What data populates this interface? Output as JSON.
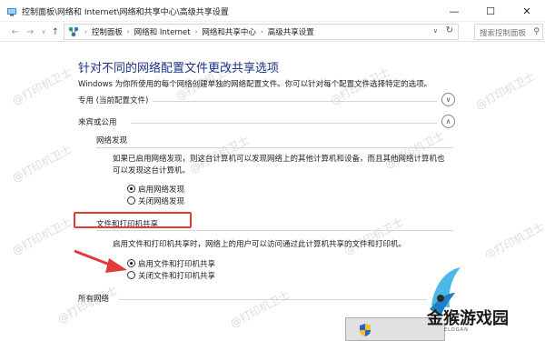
{
  "window": {
    "title": "控制面板\\网络和 Internet\\网络和共享中心\\高级共享设置",
    "minimize_icon": "minimize-icon",
    "maximize_icon": "maximize-icon",
    "close_icon": "close-icon"
  },
  "address": {
    "breadcrumbs": [
      "控制面板",
      "网络和 Internet",
      "网络和共享中心",
      "高级共享设置"
    ],
    "search_placeholder": "搜索控制面板"
  },
  "page": {
    "title": "针对不同的网络配置文件更改共享选项",
    "description": "Windows 为你所使用的每个网络创建单独的网络配置文件。你可以针对每个配置文件选择特定的选项。"
  },
  "profiles": {
    "private_label": "专用 (当前配置文件)",
    "guest_label": "来宾或公用",
    "all_label": "所有网络"
  },
  "network_discovery": {
    "heading": "网络发现",
    "text_line1": "如果已启用网络发现，则这台计算机可以发现网络上的其他计算机和设备，而且其他网络计算机也",
    "text_line2": "可以发现这台计算机。",
    "option_on": "启用网络发现",
    "option_off": "关闭网络发现",
    "selected": "启用网络发现"
  },
  "file_sharing": {
    "heading": "文件和打印机共享",
    "text": "启用文件和打印机共享时，网络上的用户可以访问通过此计算机共享的文件和打印机。",
    "option_on": "启用文件和打印机共享",
    "option_off": "关闭文件和打印机共享",
    "selected": "启用文件和打印机共享"
  },
  "watermark": "@打印机卫士",
  "logo": {
    "text": "金猴游戏园",
    "sub": "ELDGAN"
  },
  "colors": {
    "title_blue": "#1e3287",
    "highlight_red": "#e23a3a",
    "arrow_red": "#e23a3a"
  }
}
